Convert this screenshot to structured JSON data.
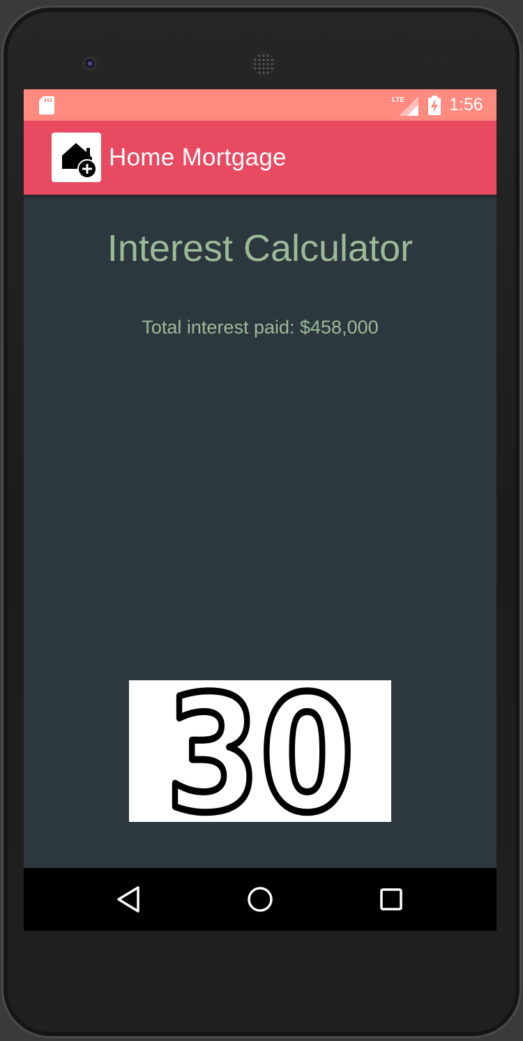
{
  "status_bar": {
    "time": "1:56",
    "network": "LTE",
    "icons": [
      "sd-card-icon",
      "lte-signal-icon",
      "battery-charging-icon"
    ],
    "background_color": "#ff8a80"
  },
  "app_bar": {
    "title": "Home Mortgage",
    "icon": "home-add-icon",
    "background_color": "#e84a62"
  },
  "main": {
    "heading": "Interest Calculator",
    "total_interest": "Total interest paid: $458,000",
    "text_color": "#9bbb98",
    "background_color": "#2d373e",
    "term_image": {
      "text": "30"
    }
  },
  "nav_bar": {
    "buttons": [
      "back-icon",
      "home-icon",
      "recents-icon"
    ]
  }
}
